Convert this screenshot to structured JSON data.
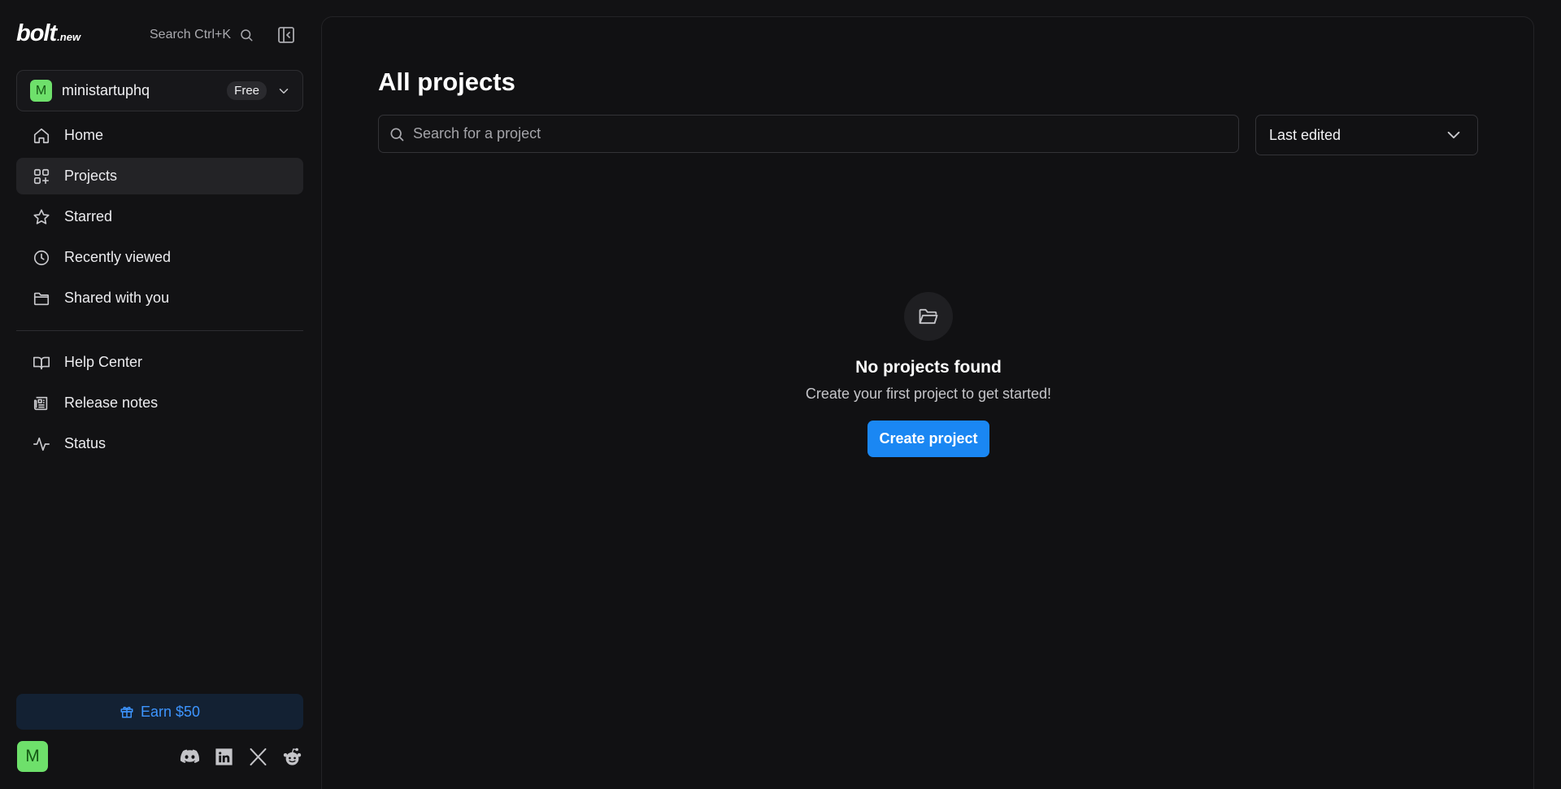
{
  "sidebar": {
    "logo": {
      "main": "bolt",
      "suffix": ".new"
    },
    "search_shortcut": "Search Ctrl+K",
    "workspace": {
      "avatar": "M",
      "name": "ministartuphq",
      "plan": "Free"
    },
    "nav": [
      {
        "label": "Home",
        "icon": "home-icon"
      },
      {
        "label": "Projects",
        "icon": "projects-icon",
        "active": true
      },
      {
        "label": "Starred",
        "icon": "star-icon"
      },
      {
        "label": "Recently viewed",
        "icon": "clock-icon"
      },
      {
        "label": "Shared with you",
        "icon": "folder-icon"
      }
    ],
    "nav_secondary": [
      {
        "label": "Help Center",
        "icon": "book-icon"
      },
      {
        "label": "Release notes",
        "icon": "newspaper-icon"
      },
      {
        "label": "Status",
        "icon": "activity-icon"
      }
    ],
    "earn_label": "Earn $50",
    "user_avatar": "M",
    "socials": [
      "discord-icon",
      "linkedin-icon",
      "x-icon",
      "reddit-icon"
    ]
  },
  "main": {
    "title": "All projects",
    "search_placeholder": "Search for a project",
    "sort_value": "Last edited",
    "empty": {
      "title": "No projects found",
      "subtitle": "Create your first project to get started!",
      "button": "Create project"
    }
  },
  "colors": {
    "background": "#121214",
    "accent": "#1a87f3",
    "avatar": "#6ee06b",
    "earn_text": "#3d95ff"
  }
}
